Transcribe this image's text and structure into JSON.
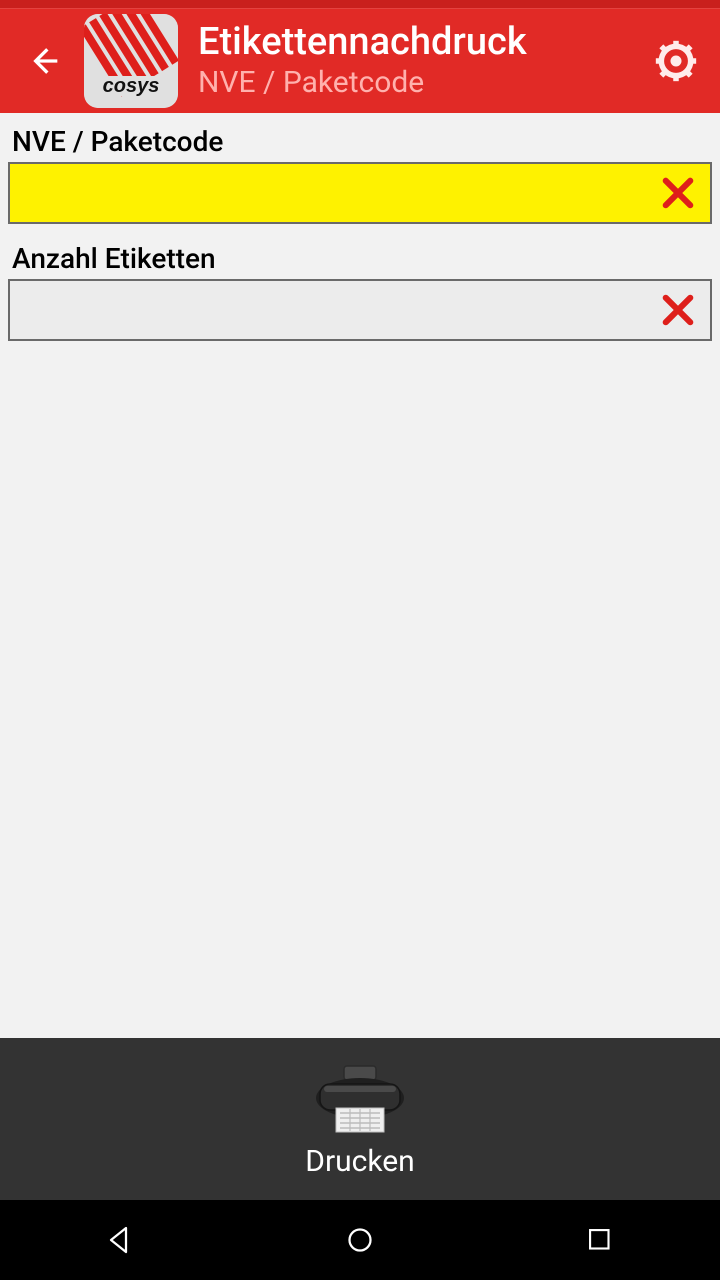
{
  "header": {
    "title": "Etikettennachdruck",
    "subtitle": "NVE / Paketcode"
  },
  "fields": {
    "paketcode": {
      "label": "NVE / Paketcode",
      "value": ""
    },
    "anzahl": {
      "label": "Anzahl Etiketten",
      "value": ""
    }
  },
  "footer": {
    "print_label": "Drucken"
  },
  "logo": {
    "text": "cosys"
  }
}
